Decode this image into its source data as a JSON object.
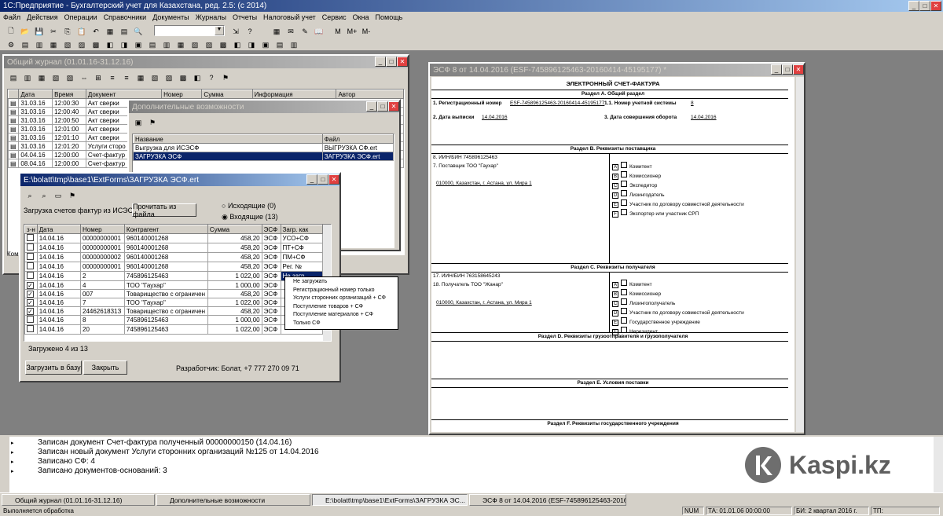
{
  "app": {
    "title": "1С:Предприятие - Бухгалтерский учет для Казахстана, ред. 2.5: (с 2014)",
    "menu": [
      "Файл",
      "Действия",
      "Операции",
      "Справочники",
      "Документы",
      "Журналы",
      "Отчеты",
      "Налоговый учет",
      "Сервис",
      "Окна",
      "Помощь"
    ]
  },
  "journal": {
    "title": "Общий журнал (01.01.16-31.12.16)",
    "columns": [
      "Дата",
      "Время",
      "Документ",
      "Номер",
      "Сумма",
      "Информация",
      "Автор"
    ],
    "rows": [
      {
        "date": "31.03.16",
        "time": "12:00:30",
        "doc": "Акт сверки"
      },
      {
        "date": "31.03.16",
        "time": "12:00:40",
        "doc": "Акт сверки"
      },
      {
        "date": "31.03.16",
        "time": "12:00:50",
        "doc": "Акт сверки"
      },
      {
        "date": "31.03.16",
        "time": "12:01:00",
        "doc": "Акт сверки"
      },
      {
        "date": "31.03.16",
        "time": "12:01:10",
        "doc": "Акт сверки"
      },
      {
        "date": "31.03.16",
        "time": "12:01:20",
        "doc": "Услуги сторо"
      },
      {
        "date": "04.04.16",
        "time": "12:00:00",
        "doc": "Счет-фактур"
      },
      {
        "date": "08.04.16",
        "time": "12:00:00",
        "doc": "Счет-фактур"
      }
    ],
    "footer": "Ком"
  },
  "addons": {
    "title": "Дополнительные возможности",
    "columns": [
      "Название",
      "Файл"
    ],
    "rows": [
      {
        "name": "Выгрузка для ИСЭСФ",
        "file": "ВЫГРУЗКА СФ.ert"
      },
      {
        "name": "ЗАГРУЗКА ЭСФ",
        "file": "ЗАГРУЗКА ЭСФ.ert"
      }
    ]
  },
  "loader": {
    "title": "E:\\bolatt\\tmp\\base1\\ExtForms\\ЗАГРУЗКА ЭСФ.ert",
    "caption": "Загрузка счетов фактур из ИСЭСФ",
    "read_button": "Прочитать из файла",
    "radio_out": "Исходящие (0)",
    "radio_in": "Входящие (13)",
    "columns": [
      "з-н",
      "Дата",
      "Номер",
      "Контрагент",
      "Сумма",
      "ЭСФ",
      "Загр. как"
    ],
    "rows": [
      {
        "chk": "",
        "date": "14.04.16",
        "num": "00000000001",
        "agent": "960140001268",
        "sum": "458,20",
        "esf": "ЭСФ",
        "as": "УСО+СФ"
      },
      {
        "chk": "",
        "date": "14.04.16",
        "num": "00000000001",
        "agent": "960140001268",
        "sum": "458,20",
        "esf": "ЭСФ",
        "as": "ПТ+СФ"
      },
      {
        "chk": "",
        "date": "14.04.16",
        "num": "00000000002",
        "agent": "960140001268",
        "sum": "458,20",
        "esf": "ЭСФ",
        "as": "ПМ+СФ"
      },
      {
        "chk": "",
        "date": "14.04.16",
        "num": "00000000001",
        "agent": "960140001268",
        "sum": "458,20",
        "esf": "ЭСФ",
        "as": "Рег. №"
      },
      {
        "chk": "",
        "date": "14.04.16",
        "num": "2",
        "agent": "745896125463",
        "sum": "1 022,00",
        "esf": "ЭСФ",
        "as": "Не загр."
      },
      {
        "chk": "✓",
        "date": "14.04.16",
        "num": "4",
        "agent": "ТОО \"Гаухар\"",
        "sum": "1 000,00",
        "esf": "ЭСФ",
        "as": ""
      },
      {
        "chk": "✓",
        "date": "14.04.16",
        "num": "007",
        "agent": "Товарищество с ограничен",
        "sum": "458,20",
        "esf": "ЭСФ",
        "as": ""
      },
      {
        "chk": "✓",
        "date": "14.04.16",
        "num": "7",
        "agent": "ТОО \"Гаухар\"",
        "sum": "1 022,00",
        "esf": "ЭСФ",
        "as": ""
      },
      {
        "chk": "✓",
        "date": "14.04.16",
        "num": "2446261831З",
        "agent": "Товарищество с ограничен",
        "sum": "458,20",
        "esf": "ЭСФ",
        "as": ""
      },
      {
        "chk": "",
        "date": "14.04.16",
        "num": "8",
        "agent": "745896125463",
        "sum": "1 000,00",
        "esf": "ЭСФ",
        "as": ""
      },
      {
        "chk": "",
        "date": "14.04.16",
        "num": "20",
        "agent": "745896125463",
        "sum": "1 022,00",
        "esf": "ЭСФ",
        "as": ""
      }
    ],
    "status": "Загружено 4 из 13",
    "load_button": "Загрузить в базу",
    "close_button": "Закрыть",
    "developer": "Разработчик: Болат, +7 777 270 09 71"
  },
  "dropdown": [
    "Не загружать",
    "Регистрационный номер только",
    "Услуги сторонних организаций + СФ",
    "Поступление товаров + СФ",
    "Поступление материалов + СФ",
    "Только СФ"
  ],
  "esf": {
    "title": "ЭСФ 8 от 14.04.2016 (ESF-745896125463-20160414-45195177) *",
    "heading": "ЭЛЕКТРОННЫЙ СЧЕТ-ФАКТУРА",
    "secA": "Раздел А. Общий раздел",
    "regnum_label": "1. Регистрационный номер",
    "regnum": "ESF-745896125463-20160414-45195177",
    "acc_label": "1.1. Номер учетной системы",
    "acc": "8",
    "date_label": "2. Дата выписки",
    "date": "14.04.2016",
    "turn_label": "3. Дата совершения оборота",
    "turn": "14.04.2016",
    "secB": "Раздел В. Реквизиты поставщика",
    "seller_iin": "8. ИИН/БИН 745896125463",
    "seller_name": "7. Поставщик ТОО \"Гаухар\"",
    "seller_addr": "010000, Казахстан, г. Астана, ул. Мира 1",
    "seller_cats": [
      "Комитент",
      "Комиссионер",
      "Экспедитор",
      "Лизингодатель",
      "Участник по договору совместной деятельности",
      "Экспортер или участник СРП"
    ],
    "secC": "Раздел С. Реквизиты получателя",
    "buyer_iin": "17. ИИН/БИН 763158645243",
    "buyer_name": "18. Получатель ТОО \"Жанар\"",
    "buyer_addr": "010000, Казахстан, г. Астана, ул. Мира 1",
    "buyer_cats": [
      "Комитент",
      "Комиссионер",
      "Лизингополучатель",
      "Участник по договору совместной деятельности",
      "Государственное учреждение",
      "Нерезидент"
    ],
    "secD": "Раздел D. Реквизиты грузоотправителя и грузополучателя",
    "secE": "Раздел Е. Условия поставки",
    "secF": "Раздел F. Реквизиты государственного учреждения"
  },
  "log": [
    "Записан документ Счет-фактура полученный 00000000150 (14.04.16)",
    "Записан новый документ Услуги сторонних организаций №125 от 14.04.2016",
    "Записано СФ: 4",
    "Записано документов-оснований: 3"
  ],
  "watermark": "Kaspi.kz",
  "taskbar": [
    "Общий журнал (01.01.16-31.12.16)",
    "Дополнительные возможности",
    "E:\\bolatt\\tmp\\base1\\ExtForms\\ЗАГРУЗКА ЭС...",
    "ЭСФ 8 от 14.04.2016 (ESF-745896125463-20160414-451..."
  ],
  "status": {
    "left": "Выполняется обработка",
    "num": "NUM",
    "ta": "ТА: 01.01.06 00:00:00",
    "bi": "БИ: 2 квартал 2016 г.",
    "tp": "ТП:"
  }
}
